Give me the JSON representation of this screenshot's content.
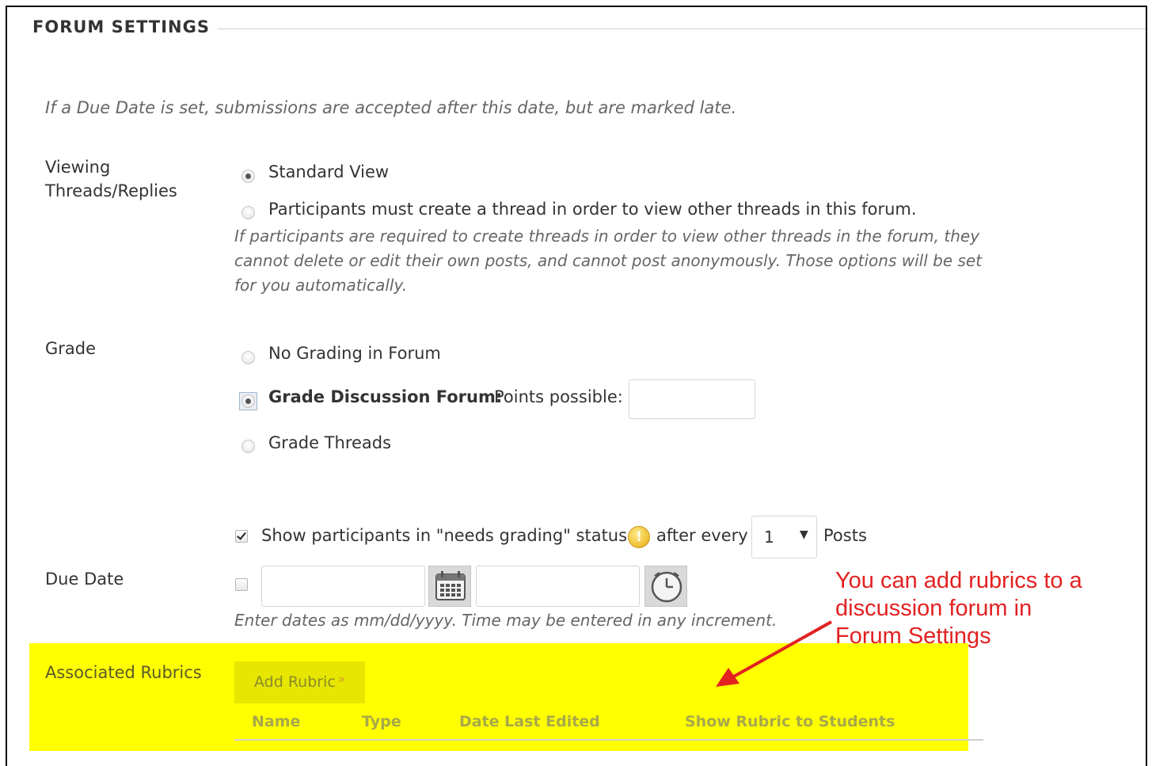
{
  "section": {
    "title": "FORUM SETTINGS"
  },
  "due_date_note": "If a Due Date is set, submissions are accepted after this date, but are marked late.",
  "viewing": {
    "label_line1": "Viewing",
    "label_line2": "Threads/Replies",
    "option_standard": "Standard View",
    "option_must_create": "Participants must create a thread in order to view other threads in this forum.",
    "help_line1": "If participants are required to create threads in order to view other threads in the forum, they",
    "help_line2": "cannot delete or edit their own posts, and cannot post anonymously. Those options will be set",
    "help_line3": "for you automatically.",
    "selected": "Standard View"
  },
  "grade": {
    "label": "Grade",
    "option_none": "No Grading in Forum",
    "option_forum_bold": "Grade Discussion Forum:",
    "option_forum_points": "Points possible:",
    "points_value": "",
    "option_threads": "Grade Threads",
    "selected": "Grade Discussion Forum:"
  },
  "needs_grading": {
    "checked": true,
    "text_before": "Show participants in \"needs grading\" status",
    "text_after": "after every",
    "posts_value": "1",
    "posts_label": "Posts",
    "icon": "warning-icon"
  },
  "due_date": {
    "label": "Due Date",
    "checked": false,
    "date_value": "",
    "time_value": "",
    "hint": "Enter dates as mm/dd/yyyy. Time may be entered in any increment.",
    "calendar_icon": "calendar-icon",
    "clock_icon": "clock-icon"
  },
  "rubrics": {
    "label": "Associated Rubrics",
    "add_button": "Add Rubric",
    "columns": [
      "Name",
      "Type",
      "Date Last Edited",
      "Show Rubric to Students"
    ],
    "highlight_color": "#ffff00"
  },
  "annotation": {
    "line1": "You can add rubrics to a",
    "line2": "discussion forum in",
    "line3": "Forum Settings",
    "color": "#e32121"
  }
}
